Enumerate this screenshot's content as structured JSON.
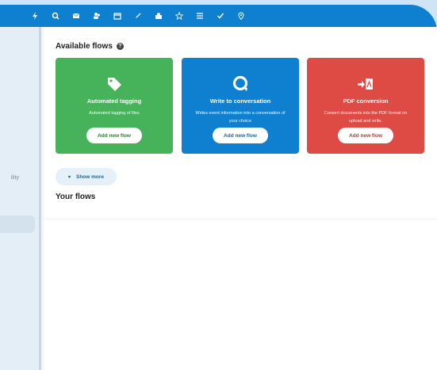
{
  "topbar": {
    "icons": [
      "lightning-icon",
      "search-icon",
      "mail-icon",
      "contacts-icon",
      "calendar-icon",
      "pencil-icon",
      "files-icon",
      "star-icon",
      "list-icon",
      "check-icon",
      "location-icon"
    ]
  },
  "sidebar": {
    "partial_label": "ility"
  },
  "available": {
    "heading": "Available flows",
    "help": "?"
  },
  "cards": [
    {
      "title": "Automated tagging",
      "desc": "Automated tagging of files",
      "button": "Add new flow",
      "color": "#46b25a",
      "icon": "tag-icon"
    },
    {
      "title": "Write to conversation",
      "desc": "Writes event information into a conversation of your choice",
      "button": "Add new flow",
      "color": "#0f7fcf",
      "icon": "talk-icon"
    },
    {
      "title": "PDF conversion",
      "desc": "Convert documents into the PDF format on upload and write.",
      "button": "Add new flow",
      "color": "#de4b44",
      "icon": "pdf-icon"
    }
  ],
  "show_more": "Show more",
  "your_flows": "Your flows"
}
